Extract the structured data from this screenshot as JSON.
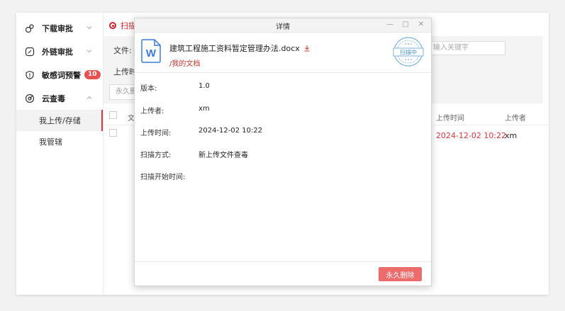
{
  "sidebar": {
    "items": [
      {
        "label": "下载审批",
        "icon": "download-approval-icon"
      },
      {
        "label": "外链审批",
        "icon": "external-link-approval-icon"
      },
      {
        "label": "敏感词预警",
        "icon": "sensitive-warning-icon",
        "badge": "10"
      },
      {
        "label": "云查毒",
        "icon": "virus-scan-icon"
      }
    ],
    "sub_items": [
      {
        "label": "我上传/存储",
        "active": true
      },
      {
        "label": "我管辖",
        "active": false
      }
    ]
  },
  "main": {
    "tab_label": "扫描",
    "file_label": "文件:",
    "upload_time_label": "上传时",
    "keyword_placeholder": "输入关键字",
    "perm_delete_label": "永久删",
    "columns": {
      "name": "文",
      "upload_time": "上传时间",
      "uploader": "上传者"
    },
    "row": {
      "upload_time": "2024-12-02 10:22",
      "uploader": "xm"
    }
  },
  "dialog": {
    "title": "详情",
    "file_name": "建筑工程施工资料暂定管理办法.docx",
    "file_path": "/我的文档",
    "stamp_text": "扫描中",
    "details": [
      {
        "label": "版本:",
        "value": "1.0"
      },
      {
        "label": "上传者:",
        "value": "xm"
      },
      {
        "label": "上传时间:",
        "value": "2024-12-02 10:22"
      },
      {
        "label": "扫描方式:",
        "value": "新上传文件查毒"
      },
      {
        "label": "扫描开始时间:",
        "value": ""
      }
    ],
    "delete_button": "永久删除"
  },
  "colors": {
    "accent": "#d9363e",
    "delete_button": "#ec6b6b",
    "stamp": "#7fb6dc"
  }
}
